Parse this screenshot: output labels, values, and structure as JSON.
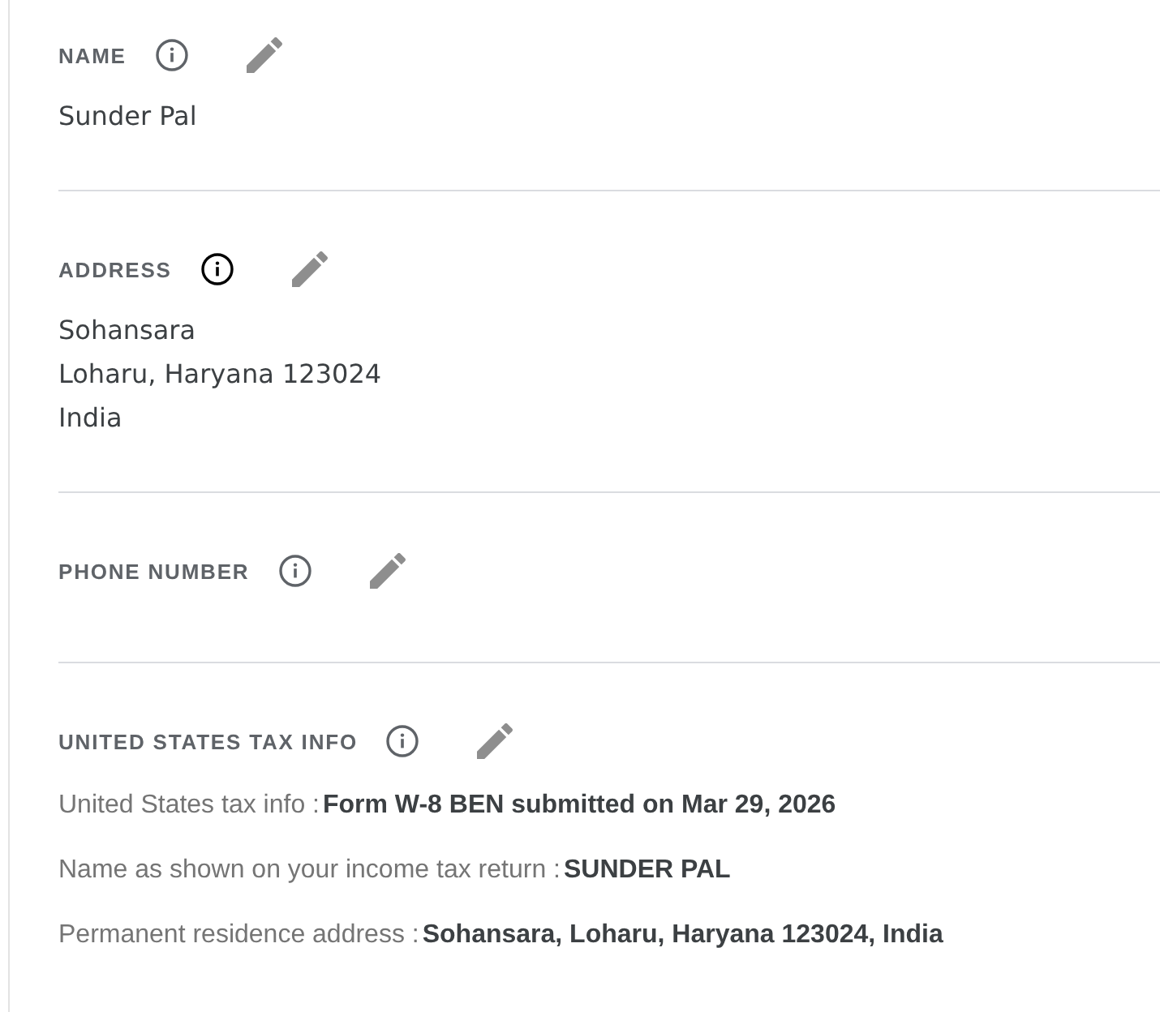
{
  "sections": [
    {
      "kind": "field",
      "label": "NAME",
      "info_highlighted": false,
      "values": [
        "Sunder Pal"
      ]
    },
    {
      "kind": "field",
      "label": "ADDRESS",
      "info_highlighted": true,
      "values": [
        "Sohansara",
        "Loharu, Haryana 123024",
        "India"
      ]
    },
    {
      "kind": "field",
      "label": "PHONE NUMBER",
      "info_highlighted": false
    },
    {
      "kind": "details",
      "label": "UNITED STATES TAX INFO",
      "info_highlighted": false,
      "rows": [
        {
          "label": "United States tax info :",
          "value": "Form W-8 BEN submitted on Mar 29, 2026"
        },
        {
          "label": "Name as shown on your income tax return :",
          "value": "SUNDER PAL"
        },
        {
          "label": "Permanent residence address :",
          "value": "Sohansara, Loharu, Haryana 123024, India"
        }
      ]
    }
  ]
}
